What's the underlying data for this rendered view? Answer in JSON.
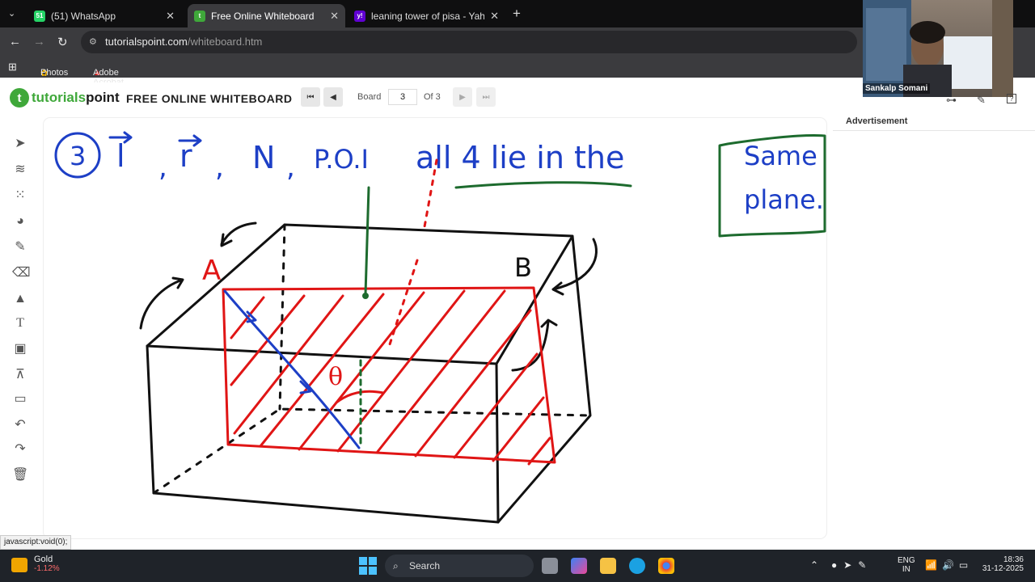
{
  "browser": {
    "tabs": [
      {
        "title": "(51) WhatsApp",
        "badge": "51"
      },
      {
        "title": "Free Online Whiteboard"
      },
      {
        "title": "leaning tower of pisa - Yahoo In"
      }
    ],
    "url_host": "tutorialspoint.com",
    "url_path": "/whiteboard.htm",
    "bookmarks": [
      "Photos",
      "Adobe Acrobat"
    ]
  },
  "whiteboard": {
    "brand_prefix": "tutorials",
    "brand_suffix": "point",
    "title": "FREE ONLINE WHITEBOARD",
    "board_label": "Board",
    "board_number": "3",
    "board_of": "Of 3",
    "advertisement": "Advertisement"
  },
  "video": {
    "participant": "Sankalp Somani"
  },
  "status_bar": "javascript:void(0);",
  "taskbar": {
    "widget_title": "Gold",
    "widget_value": "-1.12%",
    "search": "Search",
    "lang_top": "ENG",
    "lang_bottom": "IN",
    "time": "18:36",
    "date": "31-12-2025"
  },
  "drawing": {
    "annotations": {
      "circled_number": "3",
      "sequence": [
        "l",
        "r",
        "N",
        "P.O.I"
      ],
      "phrase": "all 4 lie in the",
      "boxed": [
        "Same",
        "plane."
      ],
      "label_a": "A",
      "label_b": "B",
      "angle": "θ"
    },
    "colors": {
      "ink_blue": "#1d3fc6",
      "ink_red": "#e01515",
      "ink_green": "#1d6b2e",
      "ink_black": "#111111"
    }
  }
}
